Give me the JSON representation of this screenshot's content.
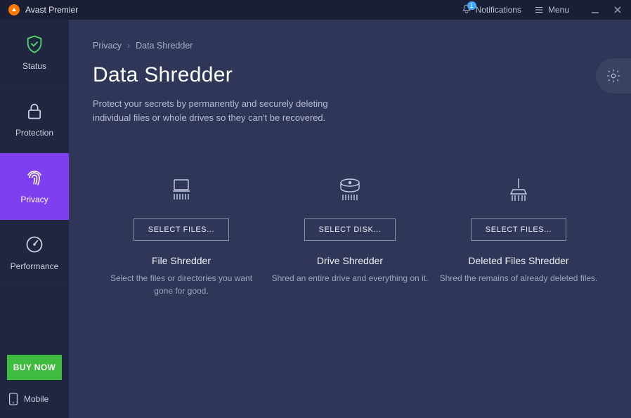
{
  "titlebar": {
    "app_name": "Avast Premier",
    "notifications_label": "Notifications",
    "notifications_count": "1",
    "menu_label": "Menu"
  },
  "sidebar": {
    "items": [
      {
        "label": "Status"
      },
      {
        "label": "Protection"
      },
      {
        "label": "Privacy"
      },
      {
        "label": "Performance"
      }
    ],
    "buy_label": "BUY NOW",
    "mobile_label": "Mobile"
  },
  "breadcrumb": {
    "parent": "Privacy",
    "current": "Data Shredder"
  },
  "page": {
    "title": "Data Shredder",
    "description": "Protect your secrets by permanently and securely deleting individual files or whole drives so they can't be recovered."
  },
  "cards": [
    {
      "button": "SELECT FILES...",
      "title": "File Shredder",
      "desc": "Select the files or directories you want gone for good."
    },
    {
      "button": "SELECT DISK...",
      "title": "Drive Shredder",
      "desc": "Shred an entire drive and everything on it."
    },
    {
      "button": "SELECT FILES...",
      "title": "Deleted Files Shredder",
      "desc": "Shred the remains of already deleted files."
    }
  ]
}
